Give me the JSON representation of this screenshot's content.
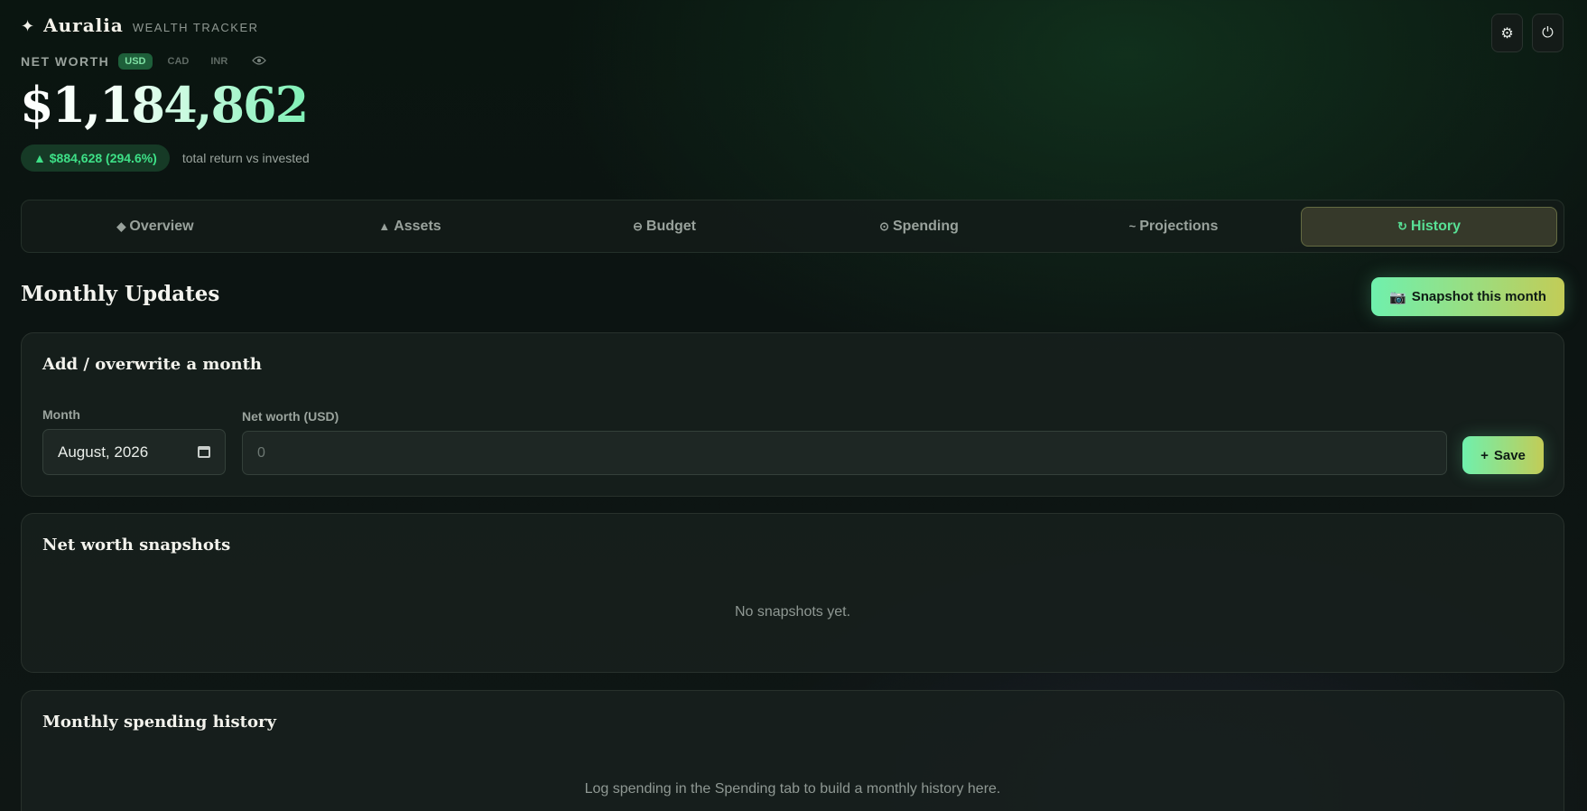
{
  "brand": {
    "star": "✦",
    "name": "Auralia",
    "subtitle": "WEALTH TRACKER"
  },
  "net_worth": {
    "label": "NET WORTH",
    "currencies": [
      "USD",
      "CAD",
      "INR"
    ],
    "selected_currency": "USD",
    "value": "$1,184,862",
    "return_badge": "▲ $884,628 (294.6%)",
    "return_note": "total return vs invested"
  },
  "header_buttons": {
    "settings_icon": "⚙",
    "power_icon": "⏻"
  },
  "tabs": [
    {
      "icon": "◆",
      "label": "Overview"
    },
    {
      "icon": "▲",
      "label": "Assets"
    },
    {
      "icon": "⊖",
      "label": "Budget"
    },
    {
      "icon": "⊙",
      "label": "Spending"
    },
    {
      "icon": "~",
      "label": "Projections"
    },
    {
      "icon": "↻",
      "label": "History"
    }
  ],
  "active_tab": "History",
  "section": {
    "title": "Monthly Updates",
    "snapshot_icon": "📷",
    "snapshot_label": "Snapshot this month"
  },
  "add_card": {
    "title": "Add / overwrite a month",
    "month_label": "Month",
    "month_value": "August, 2026",
    "networth_label": "Net worth (USD)",
    "networth_placeholder": "0",
    "save_icon": "+",
    "save_label": "Save"
  },
  "snapshots_card": {
    "title": "Net worth snapshots",
    "empty": "No snapshots yet."
  },
  "spending_card": {
    "title": "Monthly spending history",
    "empty": "Log spending in the Spending tab to build a monthly history here."
  },
  "colors": {
    "accent_green": "#3ee087",
    "active_tab_bg": "#36392a",
    "button_gradient_start": "#6ff0ad",
    "button_gradient_end": "#c2cc57"
  }
}
